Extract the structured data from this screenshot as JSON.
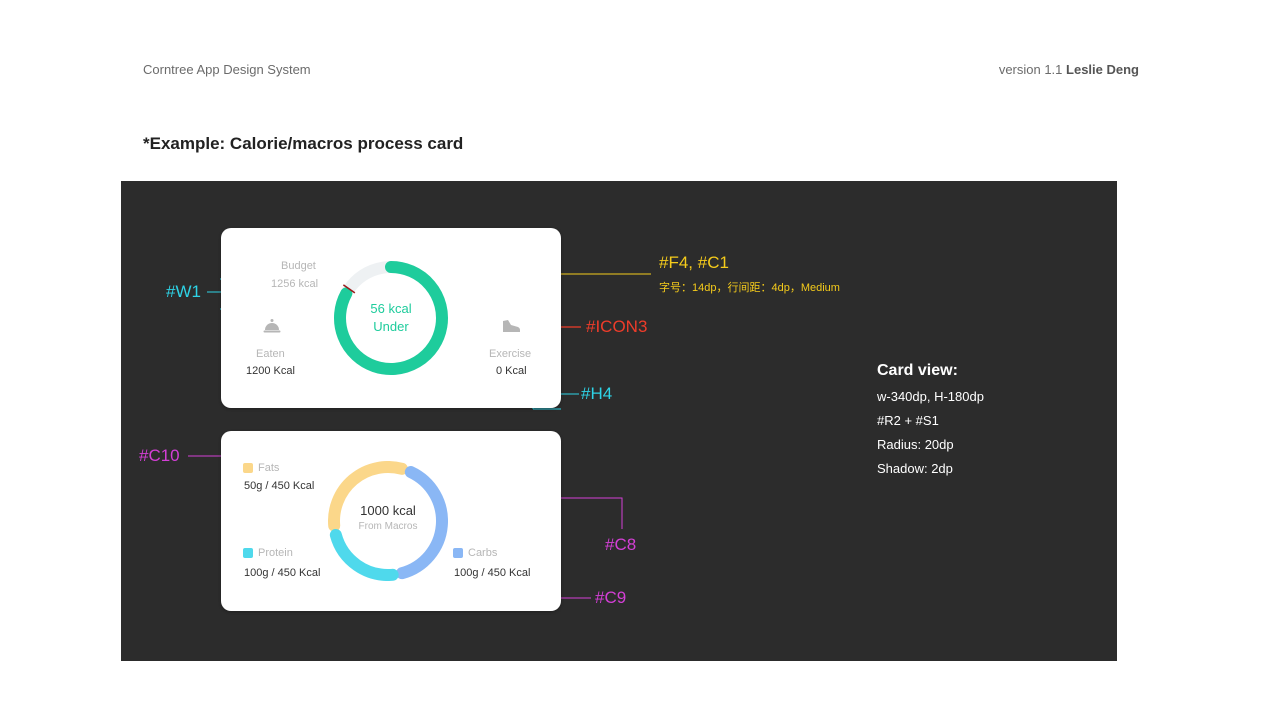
{
  "header": {
    "left": "Corntree App Design System",
    "version": "version 1.1",
    "author": "Leslie Deng"
  },
  "section_title": "*Example: Calorie/macros process card",
  "calorie_card": {
    "budget_label": "Budget",
    "budget_value": "1256 kcal",
    "eaten_label": "Eaten",
    "eaten_value": "1200 Kcal",
    "exercise_label": "Exercise",
    "exercise_value": "0 Kcal",
    "ring_value": "56 kcal",
    "ring_status": "Under",
    "ring_progress": 0.955,
    "ring_color": "#1ecc9c",
    "track_color": "#eef1f3",
    "eaten_icon": "serving-dish-icon",
    "exercise_icon": "sneaker-icon"
  },
  "macro_card": {
    "center_value": "1000 kcal",
    "center_label": "From Macros",
    "fats": {
      "label": "Fats",
      "value": "50g / 450 Kcal",
      "color": "#fbd78a"
    },
    "protein": {
      "label": "Protein",
      "value": "100g / 450 Kcal",
      "color": "#4fd9ec"
    },
    "carbs": {
      "label": "Carbs",
      "value": "100g / 450 Kcal",
      "color": "#8ab7f5"
    }
  },
  "annotations": {
    "w1": "#W1",
    "f4c1": "#F4, #C1",
    "f4c1_note": "字号：14dp，行间距：4dp，Medium",
    "icon3": "#ICON3",
    "h4": "#H4",
    "c10": "#C10",
    "c8": "#C8",
    "c9": "#C9"
  },
  "card_view": {
    "title": "Card view:",
    "size": "w-340dp, H-180dp",
    "style": "#R2 + #S1",
    "radius": "Radius: 20dp",
    "shadow": "Shadow: 2dp"
  }
}
